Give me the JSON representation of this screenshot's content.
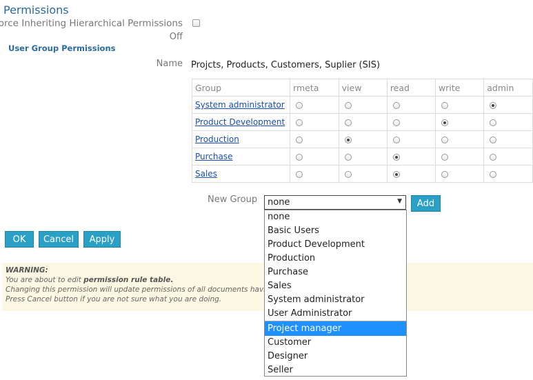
{
  "header": {
    "title": "Permissions"
  },
  "force": {
    "label": "Force Inheriting Hierarchical Permissions",
    "state": "Off"
  },
  "user_group": {
    "title": "User Group Permissions",
    "name_label": "Name",
    "name_value": "Projcts, Products, Customers, Suplier (SIS)"
  },
  "table": {
    "columns": [
      "Group",
      "rmeta",
      "view",
      "read",
      "write",
      "admin"
    ],
    "rows": [
      {
        "group": "System administrator",
        "selected": "admin"
      },
      {
        "group": "Product Development",
        "selected": "write"
      },
      {
        "group": "Production",
        "selected": "view"
      },
      {
        "group": "Purchase",
        "selected": "read"
      },
      {
        "group": "Sales",
        "selected": "read"
      }
    ]
  },
  "new_group": {
    "label": "New Group",
    "value": "none",
    "add_label": "Add",
    "options_top": [
      "none",
      "Basic Users",
      "Product Development",
      "Production",
      "Purchase",
      "Sales",
      "System administrator",
      "User Administrator"
    ],
    "highlighted": "Project manager",
    "options_bottom": [
      "Customer",
      "Designer",
      "Seller"
    ]
  },
  "buttons": {
    "ok": "OK",
    "cancel": "Cancel",
    "apply": "Apply"
  },
  "warning": {
    "heading": "WARNING:",
    "line1_pre": "You are about to edit ",
    "line1_bold": "permission rule table.",
    "line2": "Changing this permission will update permissions of all documents having",
    "line3": "Press Cancel button if you are not sure what you are doing."
  }
}
